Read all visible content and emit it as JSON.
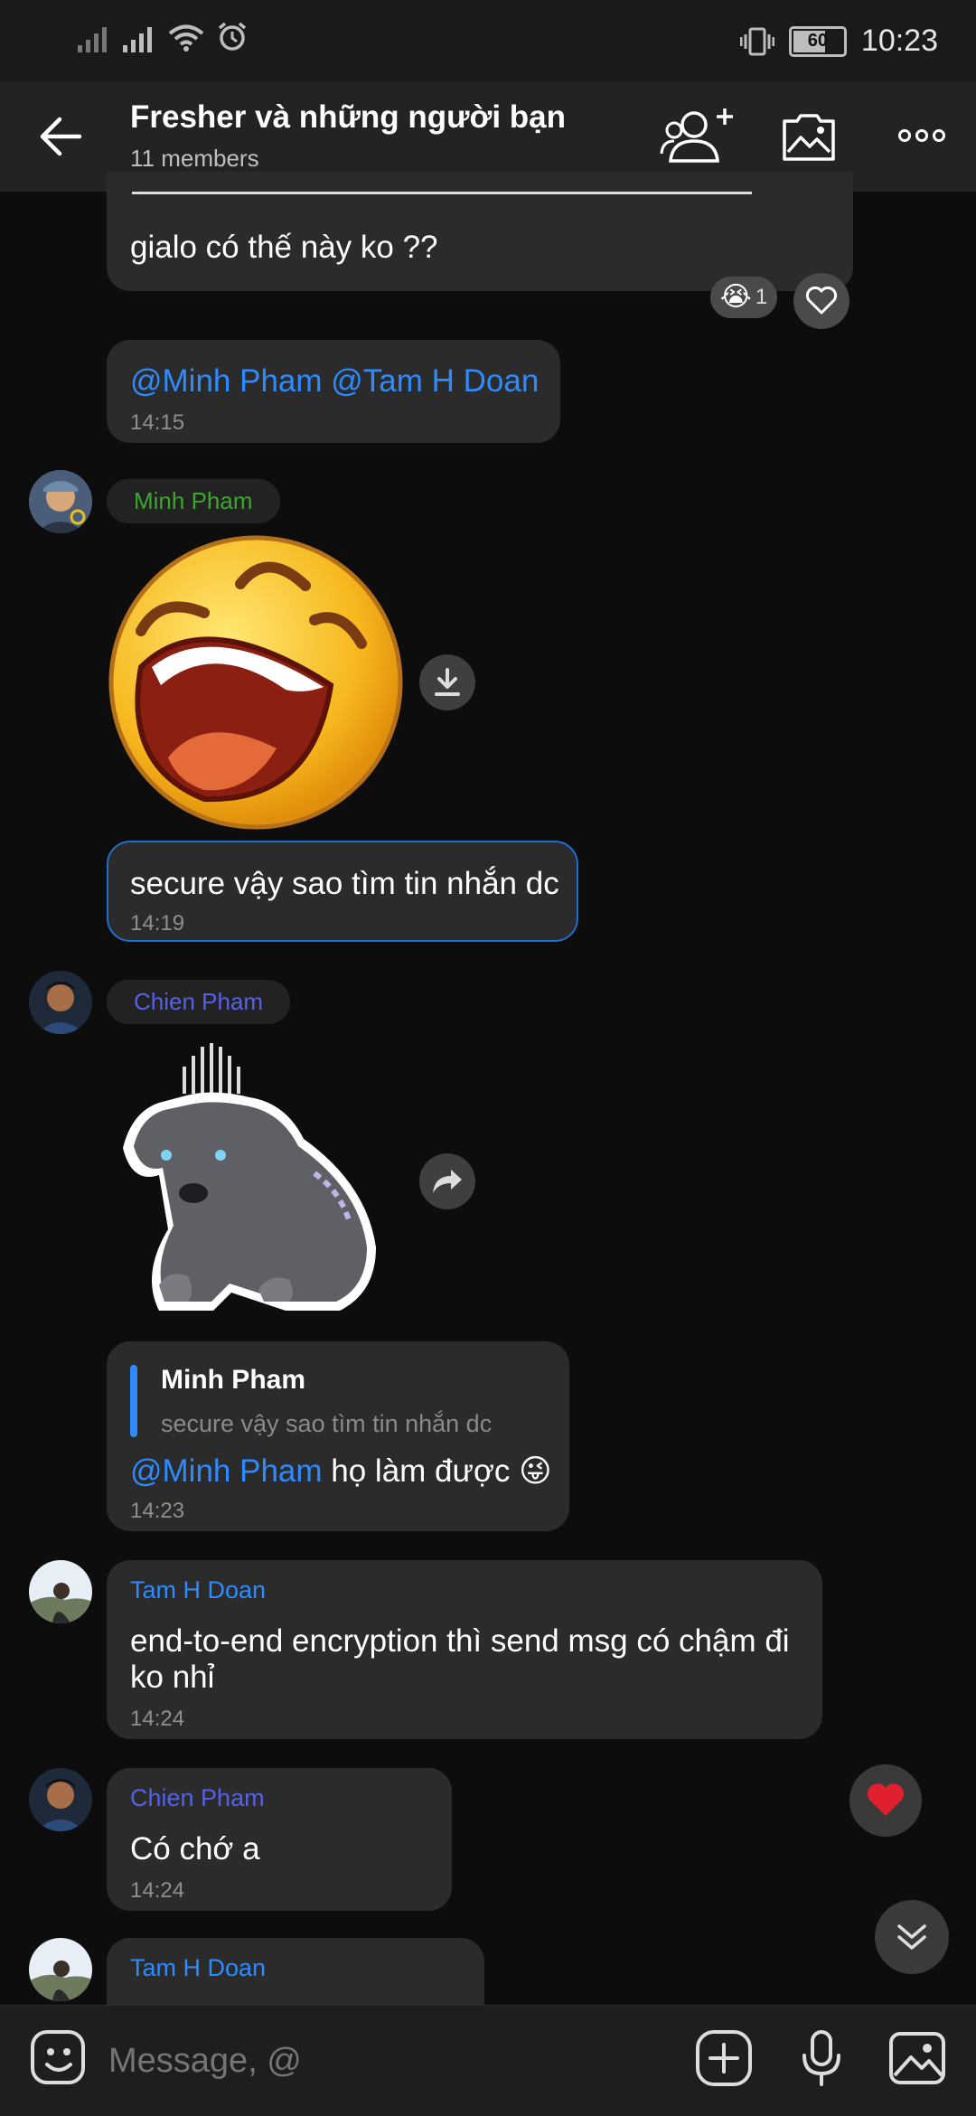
{
  "status_bar": {
    "time": "10:23",
    "battery": "60"
  },
  "header": {
    "title": "Fresher và những người bạn",
    "subtitle": "11 members"
  },
  "messages": {
    "m1": {
      "text": "gialo có thế này ko ??",
      "reaction_count": "1"
    },
    "m2": {
      "mention1": "@Minh Pham",
      "mention2": "@Tam H Doan",
      "time": "14:15"
    },
    "m3": {
      "sender": "Minh Pham"
    },
    "m4": {
      "text": "secure vậy sao tìm tin nhắn dc",
      "time": "14:19"
    },
    "m5": {
      "sender": "Chien Pham"
    },
    "m6": {
      "quote_name": "Minh Pham",
      "quote_text": "secure vậy sao tìm tin nhắn dc",
      "mention": "@Minh Pham",
      "text": " họ làm được",
      "emoji": "😜",
      "time": "14:23"
    },
    "m7": {
      "sender": "Tam H Doan",
      "text": "end-to-end encryption thì send msg có chậm đi ko nhỉ",
      "time": "14:24"
    },
    "m8": {
      "sender": "Chien Pham",
      "text": "Có chớ a",
      "time": "14:24"
    },
    "m9": {
      "sender": "Tam H Doan"
    }
  },
  "input": {
    "placeholder": "Message, @"
  },
  "colors": {
    "accent": "#2e8bff",
    "minh": "#3aa62b",
    "chien": "#5561e6",
    "tam": "#2e8bff"
  },
  "icons": {
    "back": "back-arrow-icon",
    "add_member": "add-member-icon",
    "gallery": "gallery-icon",
    "more": "more-icon",
    "download": "download-icon",
    "share": "share-icon",
    "heart_reaction": "heart-icon",
    "scroll_down": "chevron-down-icon",
    "emoji": "emoji-icon",
    "attach": "add-icon",
    "mic": "mic-icon",
    "image": "image-icon"
  }
}
